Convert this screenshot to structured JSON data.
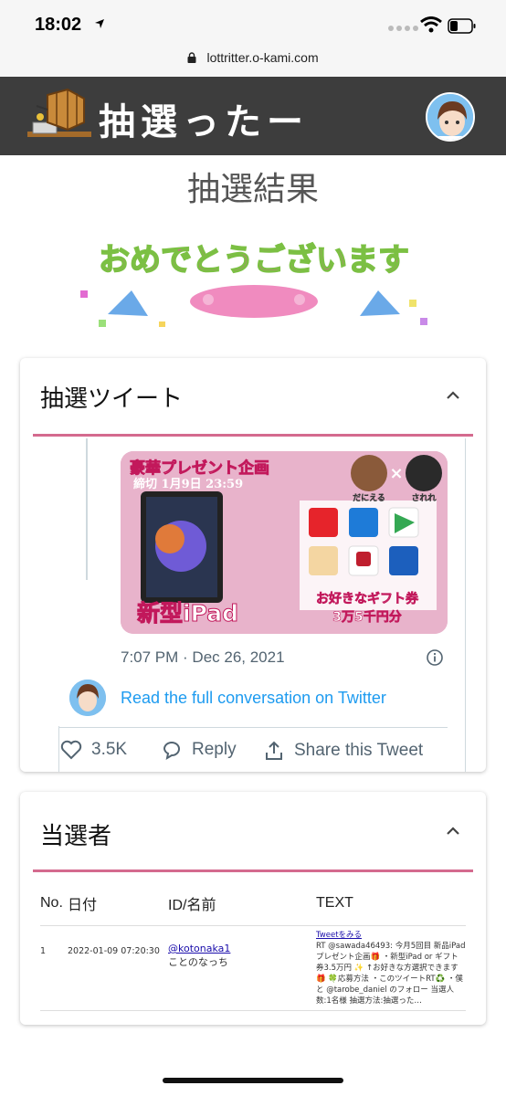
{
  "status": {
    "time": "18:02"
  },
  "browser": {
    "url": "lottritter.o-kami.com"
  },
  "header": {
    "title": "抽選ったー"
  },
  "page": {
    "title": "抽選結果",
    "congrats_text": "おめでとうございます"
  },
  "tweet_card": {
    "title": "抽選ツイート",
    "promo": {
      "headline": "豪華プレゼント企画",
      "deadline": "締切 1月9日 23:59",
      "person1": "だにえる",
      "person2": "されれ",
      "product": "新型iPad",
      "gift_line1": "お好きなギフト券",
      "gift_line2": "3万5千円分"
    },
    "timestamp": "7:07 PM · Dec 26, 2021",
    "full_conversation": "Read the full conversation on Twitter",
    "likes": "3.5K",
    "reply_label": "Reply",
    "share_label": "Share this Tweet"
  },
  "winners_card": {
    "title": "当選者",
    "columns": [
      "No.",
      "日付",
      "ID/名前",
      "TEXT"
    ],
    "rows": [
      {
        "no": "1",
        "date": "2022-01-09 07:20:30",
        "handle": "@kotonaka1",
        "name": "ことのなっち",
        "link": "Tweetをみる",
        "text": "RT @sawada46493: 今月5回目 新品iPad プレゼント企画🎁 ・新型iPad or ギフト券3.5万円 ✨ ↑お好きな方選択できます🎁 🍀応募方法 ・このツイートRT♻️ ・僕と @tarobe_daniel のフォロー 当選人数:1名様 抽選方法:抽選った…"
      }
    ]
  },
  "colors": {
    "header_bg": "#3d3d3d",
    "accent_rule": "#d46a8e",
    "twitter_blue": "#1d9bf0"
  }
}
